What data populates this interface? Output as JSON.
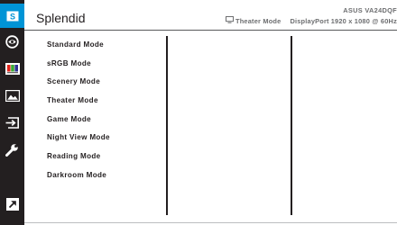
{
  "header": {
    "title": "Splendid",
    "model": "ASUS VA24DQF",
    "status": {
      "mode": "Theater Mode",
      "input": "DisplayPort",
      "resolution": "1920 x 1080 @ 60Hz"
    }
  },
  "sidebar": {
    "items": [
      {
        "icon": "splendid-icon",
        "active": true
      },
      {
        "icon": "eye-care-icon",
        "active": false
      },
      {
        "icon": "color-icon",
        "active": false
      },
      {
        "icon": "image-icon",
        "active": false
      },
      {
        "icon": "input-select-icon",
        "active": false
      },
      {
        "icon": "system-setup-icon",
        "active": false
      },
      {
        "icon": "shortcut-icon",
        "active": false
      }
    ]
  },
  "menu": {
    "items": [
      "Standard Mode",
      "sRGB Mode",
      "Scenery Mode",
      "Theater Mode",
      "Game Mode",
      "Night View Mode",
      "Reading Mode",
      "Darkroom Mode"
    ]
  },
  "colors": {
    "accent": "#0094d6",
    "sidebar": "#231f20",
    "text": "#231f20",
    "status_text": "#6d6e70"
  }
}
